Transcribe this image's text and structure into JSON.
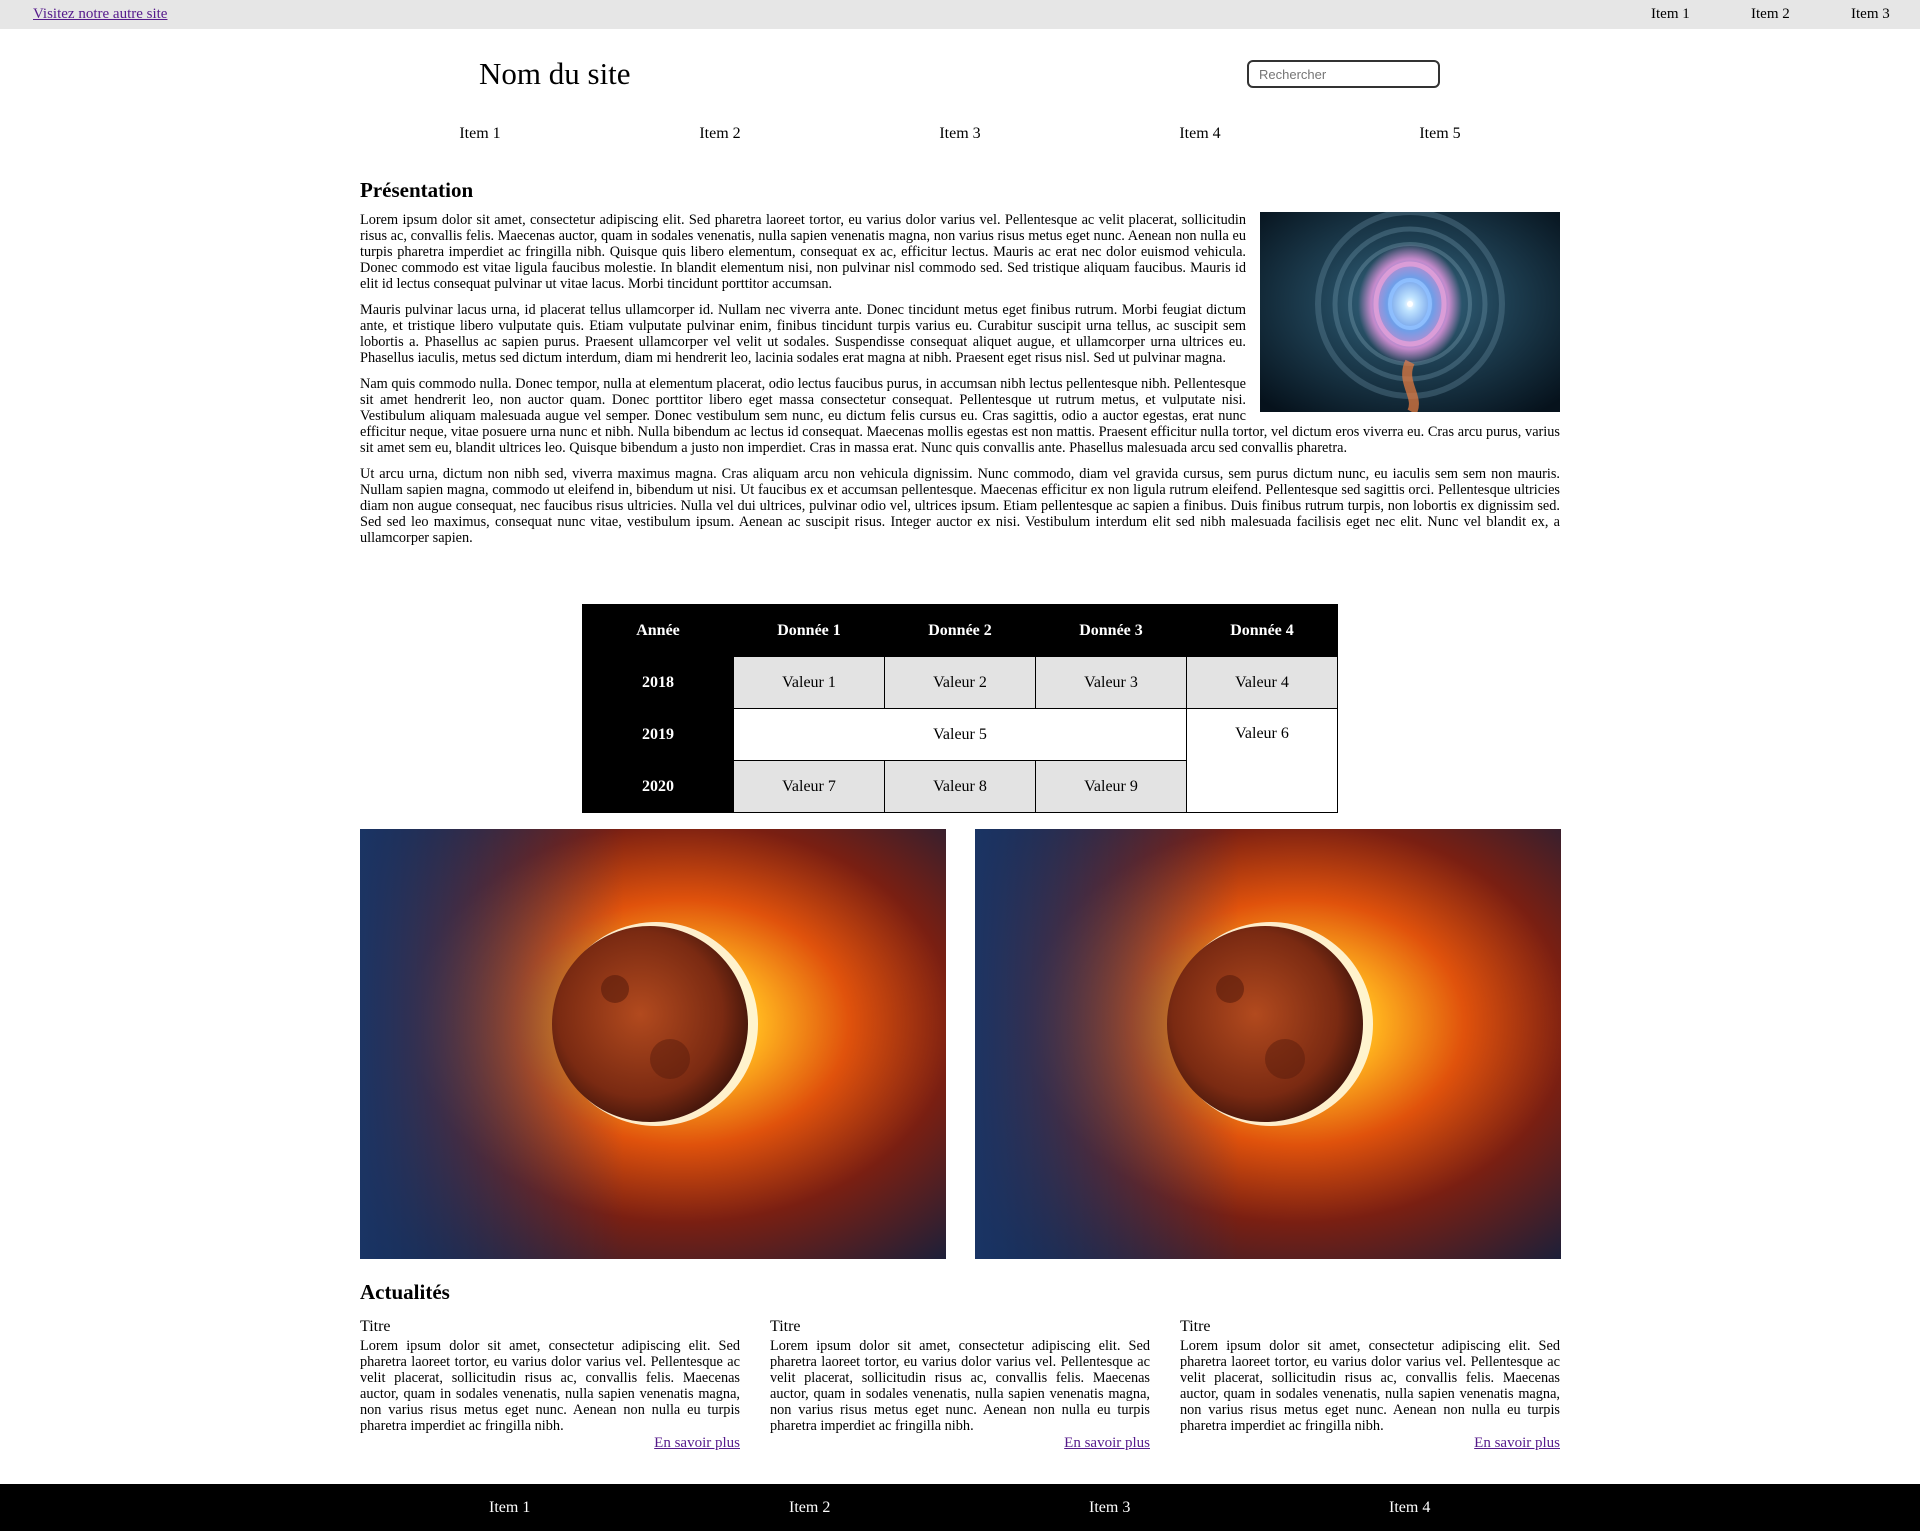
{
  "topbar": {
    "ext_link": "Visitez notre autre site",
    "items": [
      "Item 1",
      "Item 2",
      "Item 3"
    ]
  },
  "header": {
    "site_name": "Nom du site",
    "search_placeholder": "Rechercher"
  },
  "nav": {
    "items": [
      "Item 1",
      "Item 2",
      "Item 3",
      "Item 4",
      "Item 5"
    ]
  },
  "presentation": {
    "title": "Présentation",
    "paragraphs": [
      "Lorem ipsum dolor sit amet, consectetur adipiscing elit. Sed pharetra laoreet tortor, eu varius dolor varius vel. Pellentesque ac velit placerat, sollicitudin risus ac, convallis felis. Maecenas auctor, quam in sodales venenatis, nulla sapien venenatis magna, non varius risus metus eget nunc. Aenean non nulla eu turpis pharetra imperdiet ac fringilla nibh. Quisque quis libero elementum, consequat ex ac, efficitur lectus. Mauris ac erat nec dolor euismod vehicula. Donec commodo est vitae ligula faucibus molestie. In blandit elementum nisi, non pulvinar nisl commodo sed. Sed tristique aliquam faucibus. Mauris id elit id lectus consequat pulvinar ut vitae lacus. Morbi tincidunt porttitor accumsan.",
      "Mauris pulvinar lacus urna, id placerat tellus ullamcorper id. Nullam nec viverra ante. Donec tincidunt metus eget finibus rutrum. Morbi feugiat dictum ante, et tristique libero vulputate quis. Etiam vulputate pulvinar enim, finibus tincidunt turpis varius eu. Curabitur suscipit urna tellus, ac suscipit sem lobortis a. Phasellus ac sapien purus. Praesent ullamcorper vel velit ut sodales. Suspendisse consequat aliquet augue, et ullamcorper urna ultrices eu. Phasellus iaculis, metus sed dictum interdum, diam mi hendrerit leo, lacinia sodales erat magna at nibh. Praesent eget risus nisl. Sed ut pulvinar magna.",
      "Nam quis commodo nulla. Donec tempor, nulla at elementum placerat, odio lectus faucibus purus, in accumsan nibh lectus pellentesque nibh. Pellentesque sit amet hendrerit leo, non auctor quam. Donec porttitor libero eget massa consectetur consequat. Pellentesque ut rutrum metus, et vulputate nisi. Vestibulum aliquam malesuada augue vel semper. Donec vestibulum sem nunc, eu dictum felis cursus eu. Cras sagittis, odio a auctor egestas, erat nunc efficitur neque, vitae posuere urna nunc et nibh. Nulla bibendum ac lectus id consequat. Maecenas mollis egestas est non mattis. Praesent efficitur nulla tortor, vel dictum eros viverra eu. Cras arcu purus, varius sit amet sem eu, blandit ultrices leo. Quisque bibendum a justo non imperdiet. Cras in massa erat. Nunc quis convallis ante. Phasellus malesuada arcu sed convallis pharetra.",
      "Ut arcu urna, dictum non nibh sed, viverra maximus magna. Cras aliquam arcu non vehicula dignissim. Nunc commodo, diam vel gravida cursus, sem purus dictum nunc, eu iaculis sem sem non mauris. Nullam sapien magna, commodo ut eleifend in, bibendum ut nisi. Ut faucibus ex et accumsan pellentesque. Maecenas efficitur ex non ligula rutrum eleifend. Pellentesque sed sagittis orci. Pellentesque ultricies diam non augue consequat, nec faucibus risus ultricies. Nulla vel dui ultrices, pulvinar odio vel, ultrices ipsum. Etiam pellentesque ac sapien a finibus. Duis finibus rutrum turpis, non lobortis ex dignissim sed. Sed sed leo maximus, consequat nunc vitae, vestibulum ipsum. Aenean ac suscipit risus. Integer auctor ex nisi. Vestibulum interdum elit sed nibh malesuada facilisis eget nec elit. Nunc vel blandit ex, a ullamcorper sapien."
    ]
  },
  "table": {
    "headers": [
      "Année",
      "Donnée 1",
      "Donnée 2",
      "Donnée 3",
      "Donnée 4"
    ],
    "years": [
      "2018",
      "2019",
      "2020"
    ],
    "values": [
      "Valeur 1",
      "Valeur 2",
      "Valeur 3",
      "Valeur 4",
      "Valeur 5",
      "Valeur 6",
      "Valeur 7",
      "Valeur 8",
      "Valeur 9"
    ]
  },
  "news": {
    "title": "Actualités",
    "cards": [
      {
        "title": "Titre",
        "body": "Lorem ipsum dolor sit amet, consectetur adipiscing elit. Sed pharetra laoreet tortor, eu varius dolor varius vel. Pellentesque ac velit placerat, sollicitudin risus ac, convallis felis. Maecenas auctor, quam in sodales venenatis, nulla sapien venenatis magna, non varius risus metus eget nunc. Aenean non nulla eu turpis pharetra imperdiet ac fringilla nibh.",
        "link": "En savoir plus"
      },
      {
        "title": "Titre",
        "body": "Lorem ipsum dolor sit amet, consectetur adipiscing elit. Sed pharetra laoreet tortor, eu varius dolor varius vel. Pellentesque ac velit placerat, sollicitudin risus ac, convallis felis. Maecenas auctor, quam in sodales venenatis, nulla sapien venenatis magna, non varius risus metus eget nunc. Aenean non nulla eu turpis pharetra imperdiet ac fringilla nibh.",
        "link": "En savoir plus"
      },
      {
        "title": "Titre",
        "body": "Lorem ipsum dolor sit amet, consectetur adipiscing elit. Sed pharetra laoreet tortor, eu varius dolor varius vel. Pellentesque ac velit placerat, sollicitudin risus ac, convallis felis. Maecenas auctor, quam in sodales venenatis, nulla sapien venenatis magna, non varius risus metus eget nunc. Aenean non nulla eu turpis pharetra imperdiet ac fringilla nibh.",
        "link": "En savoir plus"
      }
    ]
  },
  "footer": {
    "items": [
      "Item 1",
      "Item 2",
      "Item 3",
      "Item 4"
    ]
  },
  "colors": {
    "topbar_bg": "#e6e6e6",
    "footer_bg": "#000000",
    "link_visited": "#551a8b",
    "table_cell_bg": "#e3e3e3"
  }
}
